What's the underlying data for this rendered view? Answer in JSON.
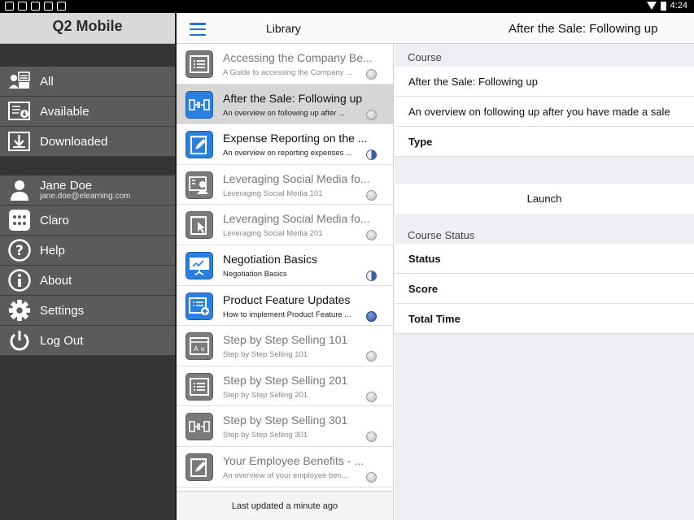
{
  "status_bar": {
    "time": "4:24"
  },
  "sidebar": {
    "title": "Q2 Mobile",
    "filters": [
      {
        "label": "All",
        "icon": "all-courses-icon"
      },
      {
        "label": "Available",
        "icon": "available-icon"
      },
      {
        "label": "Downloaded",
        "icon": "download-icon"
      }
    ],
    "user": {
      "name": "Jane Doe",
      "email": "jane.doe@elearning.com"
    },
    "menu": [
      {
        "label": "Claro",
        "icon": "grid-icon"
      },
      {
        "label": "Help",
        "icon": "help-icon"
      },
      {
        "label": "About",
        "icon": "info-icon"
      },
      {
        "label": "Settings",
        "icon": "gear-icon"
      },
      {
        "label": "Log Out",
        "icon": "power-icon"
      }
    ]
  },
  "topbar": {
    "library_title": "Library",
    "detail_title": "After the Sale: Following up"
  },
  "library": {
    "items": [
      {
        "title": "Accessing the Company Be...",
        "subtitle": "A Guide to accessing the Company ...",
        "icon": "list-doc-icon",
        "status": "none",
        "active": false,
        "blue": false
      },
      {
        "title": "After the Sale: Following up",
        "subtitle": "An overview on following up after ...",
        "icon": "sequence-icon",
        "status": "none",
        "active": true,
        "blue": true,
        "selected": true
      },
      {
        "title": "Expense Reporting on the ...",
        "subtitle": "An overview on reporting expenses ...",
        "icon": "pencil-doc-icon",
        "status": "half",
        "active": true,
        "blue": true
      },
      {
        "title": "Leveraging Social Media fo...",
        "subtitle": "Leveraging Social Media 101",
        "icon": "person-doc-icon",
        "status": "none",
        "active": false,
        "blue": false
      },
      {
        "title": "Leveraging Social Media fo...",
        "subtitle": "Leveraging Social Media 201",
        "icon": "cursor-doc-icon",
        "status": "none",
        "active": false,
        "blue": false
      },
      {
        "title": "Negotiation Basics",
        "subtitle": "Negotiation Basics",
        "icon": "presentation-icon",
        "status": "half",
        "active": true,
        "blue": true
      },
      {
        "title": "Product Feature Updates",
        "subtitle": "How to implement Product Feature ...",
        "icon": "add-doc-icon",
        "status": "full",
        "active": true,
        "blue": true
      },
      {
        "title": "Step by Step Selling 101",
        "subtitle": "Step by Step Selling 101",
        "icon": "ab-doc-icon",
        "status": "none",
        "active": false,
        "blue": false
      },
      {
        "title": "Step by Step Selling 201",
        "subtitle": "Step by Step Selling 201",
        "icon": "list-doc-icon",
        "status": "none",
        "active": false,
        "blue": false
      },
      {
        "title": "Step by Step Selling 301",
        "subtitle": "Step by Step Selling 301",
        "icon": "sequence-icon",
        "status": "none",
        "active": false,
        "blue": false
      },
      {
        "title": "Your Employee Benefits - ...",
        "subtitle": "An overview of your employee ben...",
        "icon": "pencil-doc-icon",
        "status": "none",
        "active": false,
        "blue": false
      }
    ],
    "footer": "Last updated a minute ago"
  },
  "detail": {
    "course_header": "Course",
    "course_title": "After the Sale: Following up",
    "course_description": "An overview on following up after you have made a sale",
    "type_label": "Type",
    "launch_label": "Launch",
    "status_header": "Course Status",
    "status_label": "Status",
    "score_label": "Score",
    "time_label": "Total Time"
  },
  "colors": {
    "accent": "#2b7fe0",
    "sidebar_bg": "#353535",
    "sidebar_item": "#5b5b5b"
  }
}
